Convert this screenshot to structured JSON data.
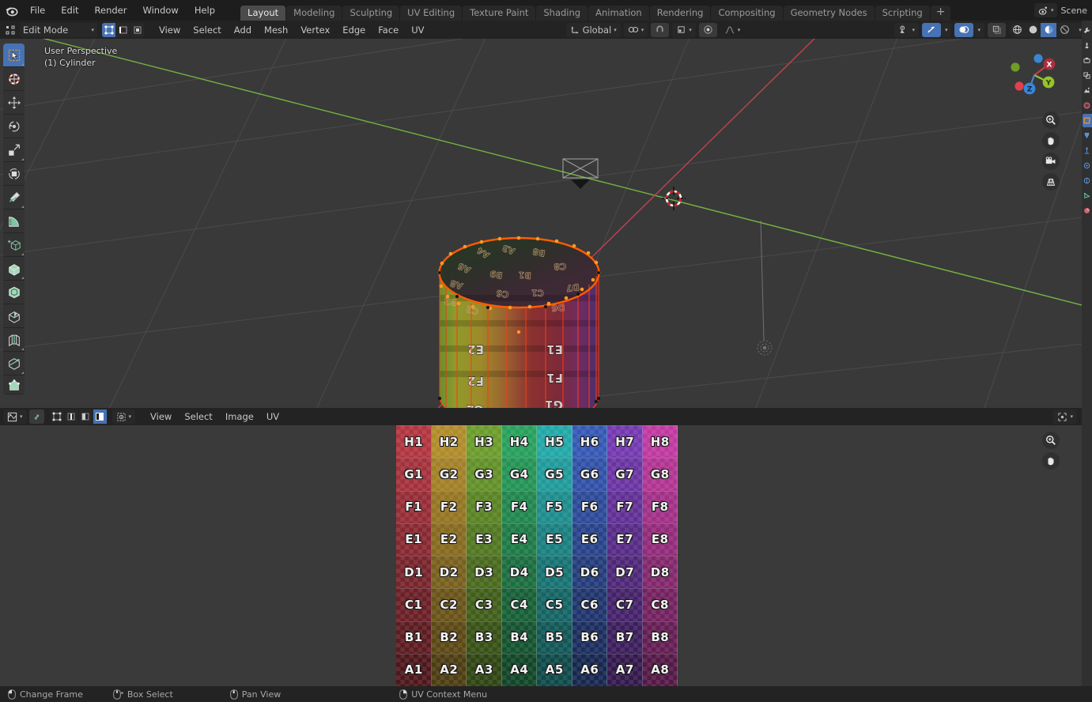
{
  "app": {
    "name": "Blender",
    "logo_icon": "blender-logo-icon"
  },
  "topbar": {
    "menus": [
      "File",
      "Edit",
      "Render",
      "Window",
      "Help"
    ],
    "workspace_tabs": [
      {
        "label": "Layout",
        "active": true
      },
      {
        "label": "Modeling",
        "active": false
      },
      {
        "label": "Sculpting",
        "active": false
      },
      {
        "label": "UV Editing",
        "active": false
      },
      {
        "label": "Texture Paint",
        "active": false
      },
      {
        "label": "Shading",
        "active": false
      },
      {
        "label": "Animation",
        "active": false
      },
      {
        "label": "Rendering",
        "active": false
      },
      {
        "label": "Compositing",
        "active": false
      },
      {
        "label": "Geometry Nodes",
        "active": false
      },
      {
        "label": "Scripting",
        "active": false
      }
    ],
    "add_workspace_label": "+",
    "scene_label": "Scene",
    "scene_icon": "scene-icon"
  },
  "viewport_header": {
    "mode": "Edit Mode",
    "mode_dropdown_icon": "chevron-down-icon",
    "mesh_select_modes": [
      {
        "name": "vertex-select-mode",
        "icon": "vertex-icon",
        "active": true
      },
      {
        "name": "edge-select-mode",
        "icon": "edge-icon",
        "active": false
      },
      {
        "name": "face-select-mode",
        "icon": "face-icon",
        "active": false
      }
    ],
    "menus": [
      "View",
      "Select",
      "Add",
      "Mesh",
      "Vertex",
      "Edge",
      "Face",
      "UV"
    ],
    "transform_orientation": "Global",
    "snap_icon": "magnet-icon",
    "pivot_icon": "pivot-icon",
    "proportional_icon": "proportional-edit-icon",
    "falloff_icon": "falloff-curve-icon",
    "xray_icon": "xray-icon",
    "visibility_icon": "visibility-icon",
    "gizmo_icon": "gizmo-icon",
    "overlays_icon": "overlays-icon",
    "shading_modes": [
      {
        "name": "wireframe-shading",
        "active": false
      },
      {
        "name": "solid-shading",
        "active": false
      },
      {
        "name": "material-preview-shading",
        "active": true
      },
      {
        "name": "rendered-shading",
        "active": false
      }
    ]
  },
  "viewport": {
    "perspective_label": "User Perspective",
    "object_label": "(1) Cylinder",
    "background_color": "#393939",
    "grid_color": "#4e4e4e",
    "x_axis_color": "#cc4455",
    "y_axis_color": "#7bc043",
    "selected_edge_color": "#ff5500",
    "active_vertex_color": "#ff9500",
    "tools": [
      {
        "name": "tweak-tool",
        "icon": "cursor-arrow-icon",
        "active": true
      },
      {
        "name": "cursor-tool",
        "icon": "3d-cursor-icon",
        "active": false
      },
      {
        "name": "move-tool",
        "icon": "move-arrows-icon",
        "active": false
      },
      {
        "name": "rotate-tool",
        "icon": "rotate-icon",
        "active": false
      },
      {
        "name": "scale-tool",
        "icon": "scale-icon",
        "active": false
      },
      {
        "name": "transform-tool",
        "icon": "transform-icon",
        "active": false
      },
      {
        "name": "annotate-tool",
        "icon": "pencil-icon",
        "active": false
      },
      {
        "name": "measure-tool",
        "icon": "ruler-icon",
        "active": false
      },
      {
        "name": "add-cube-tool",
        "icon": "add-cube-icon",
        "active": false
      },
      {
        "name": "extrude-region-tool",
        "icon": "extrude-icon",
        "active": false
      },
      {
        "name": "inset-faces-tool",
        "icon": "inset-faces-icon",
        "active": false
      },
      {
        "name": "bevel-tool",
        "icon": "bevel-icon",
        "active": false
      },
      {
        "name": "loop-cut-tool",
        "icon": "loop-cut-icon",
        "active": false
      },
      {
        "name": "knife-tool",
        "icon": "knife-icon",
        "active": false
      },
      {
        "name": "poly-build-tool",
        "icon": "poly-build-icon",
        "active": false
      }
    ],
    "gizmo": {
      "axes": [
        {
          "label": "X",
          "color": "#c9394a"
        },
        {
          "label": "Y",
          "color": "#96c32a"
        },
        {
          "label": "Z",
          "color": "#3a86d4"
        }
      ]
    },
    "nav_buttons": [
      {
        "name": "zoom-view-button",
        "icon": "magnifier-icon"
      },
      {
        "name": "pan-view-button",
        "icon": "hand-icon"
      },
      {
        "name": "camera-view-button",
        "icon": "camera-icon"
      },
      {
        "name": "toggle-perspective-button",
        "icon": "grid-perspective-icon"
      }
    ]
  },
  "uv_header": {
    "editor_type_icon": "uv-editor-icon",
    "sync_icon": "uv-sync-selection-icon",
    "select_modes": [
      {
        "name": "uv-vertex-select",
        "icon": "uv-vertex-icon",
        "active": false
      },
      {
        "name": "uv-edge-select",
        "icon": "uv-edge-icon",
        "active": false
      },
      {
        "name": "uv-face-select",
        "icon": "uv-face-icon",
        "active": false
      },
      {
        "name": "uv-island-select",
        "icon": "uv-island-icon",
        "active": true
      }
    ],
    "sticky_icon": "sticky-selection-icon",
    "menus": [
      "View",
      "Select",
      "Image",
      "UV"
    ],
    "pivot_icon": "uv-pivot-icon"
  },
  "uv_editor": {
    "background_color": "#3a3a3a",
    "image_name": "UV Grid",
    "nav_buttons": [
      {
        "name": "zoom-uv-button",
        "icon": "magnifier-icon"
      },
      {
        "name": "pan-uv-button",
        "icon": "hand-icon"
      }
    ],
    "grid_rows": [
      "H",
      "G",
      "F",
      "E",
      "D",
      "C",
      "B",
      "A"
    ],
    "grid_cols": [
      "1",
      "2",
      "3",
      "4",
      "5",
      "6",
      "7",
      "8"
    ],
    "column_colors": [
      "#b13540",
      "#b08b2a",
      "#6b9c2b",
      "#27a05c",
      "#22a7a7",
      "#3558b5",
      "#7339b0",
      "#c0399f"
    ],
    "row_shades": [
      1.0,
      0.92,
      0.84,
      0.76,
      0.68,
      0.6,
      0.52,
      0.44
    ],
    "cells": [
      [
        "H1",
        "H2",
        "H3",
        "H4",
        "H5",
        "H6",
        "H7",
        "H8"
      ],
      [
        "G1",
        "G2",
        "G3",
        "G4",
        "G5",
        "G6",
        "G7",
        "G8"
      ],
      [
        "F1",
        "F2",
        "F3",
        "F4",
        "F5",
        "F6",
        "F7",
        "F8"
      ],
      [
        "E1",
        "E2",
        "E3",
        "E4",
        "E5",
        "E6",
        "E7",
        "E8"
      ],
      [
        "D1",
        "D2",
        "D3",
        "D4",
        "D5",
        "D6",
        "D7",
        "D8"
      ],
      [
        "C1",
        "C2",
        "C3",
        "C4",
        "C5",
        "C6",
        "C7",
        "C8"
      ],
      [
        "B1",
        "B2",
        "B3",
        "B4",
        "B5",
        "B6",
        "B7",
        "B8"
      ],
      [
        "A1",
        "A2",
        "A3",
        "A4",
        "A5",
        "A6",
        "A7",
        "A8"
      ]
    ]
  },
  "properties_strip": {
    "tabs": [
      {
        "name": "tool-properties-tab",
        "color": "#c8c8c8",
        "active": false
      },
      {
        "name": "render-properties-tab",
        "color": "#c8c8c8",
        "active": false
      },
      {
        "name": "output-properties-tab",
        "color": "#c8c8c8",
        "active": false
      },
      {
        "name": "view-layer-properties-tab",
        "color": "#c8c8c8",
        "active": false
      },
      {
        "name": "scene-properties-tab",
        "color": "#c8c8c8",
        "active": false
      },
      {
        "name": "world-properties-tab",
        "color": "#d1636c",
        "active": false
      },
      {
        "name": "object-properties-tab",
        "color": "#e2913c",
        "active": true
      },
      {
        "name": "modifier-properties-tab",
        "color": "#5b8fd4",
        "active": false
      },
      {
        "name": "particle-properties-tab",
        "color": "#5b8fd4",
        "active": false
      },
      {
        "name": "physics-properties-tab",
        "color": "#5b8fd4",
        "active": false
      },
      {
        "name": "constraint-properties-tab",
        "color": "#5b8fd4",
        "active": false
      },
      {
        "name": "object-data-properties-tab",
        "color": "#5cc08e",
        "active": false
      },
      {
        "name": "material-properties-tab",
        "color": "#d1636c",
        "active": false
      }
    ]
  },
  "statusbar": {
    "hints": [
      {
        "icon": "mouse-left-icon",
        "label": "Change Frame"
      },
      {
        "icon": "mouse-middle-icon",
        "label": "Box Select"
      },
      {
        "icon": "mouse-middle-drag-icon",
        "label": "Pan View"
      },
      {
        "icon": "mouse-right-icon",
        "label": "UV Context Menu"
      }
    ]
  }
}
